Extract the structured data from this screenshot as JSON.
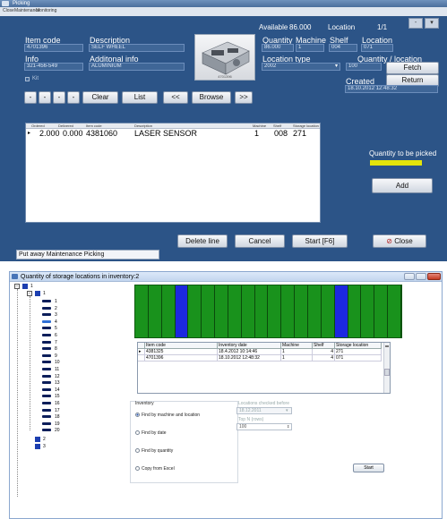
{
  "win1": {
    "title": "Picking",
    "menu": [
      "Close",
      "Maintenance",
      "Monitoring"
    ],
    "available_label": "Available",
    "available_value": "86.000",
    "location_label": "Location",
    "location_pager": "1/1",
    "item_code_label": "Item code",
    "item_code_value": "4701396",
    "description_label": "Description",
    "description_value": "SELF WHEEL",
    "info_label": "Info",
    "info_value": "321-456-549",
    "additional_info_label": "Additonal info",
    "additional_info_value": "ALUMINIUM",
    "kit_label": "Kit",
    "photo_caption": "4701396",
    "quantity_label": "Quantity",
    "quantity_value": "86.000",
    "machine_label": "Machine",
    "machine_value": "1",
    "shelf_label": "Shelf",
    "shelf_value": "004",
    "location_field_label": "Location",
    "location_field_value": "071",
    "location_type_label": "Location type",
    "location_type_value": "2002",
    "qty_location_label": "Quantity / location",
    "qty_location_value": "100",
    "created_label": "Created",
    "created_value": "18.10.2012 12:48:32",
    "buttons": {
      "nav1": "-",
      "nav2": "-",
      "nav3": "-",
      "nav4": "-",
      "clear": "Clear",
      "list": "List",
      "prev": "<<",
      "browse": "Browse",
      "next": ">>",
      "fetch": "Fetch",
      "return": "Return",
      "add": "Add",
      "delete_line": "Delete line",
      "cancel": "Cancel",
      "start": "Start [F6]",
      "close": "Close"
    },
    "table": {
      "headers": [
        "Ordered",
        "Delivered",
        "Item code",
        "Description",
        "Machine",
        "Shelf",
        "Storage location"
      ],
      "row": {
        "ordered": "2.000",
        "delivered": "0.000",
        "item_code": "4381060",
        "description": "LASER SENSOR",
        "machine": "1",
        "shelf": "008",
        "storage_location": "271"
      }
    },
    "qty_to_pick_label": "Quantity to be picked",
    "status_text": "Put away Maintenance Picking"
  },
  "win2": {
    "title": "Quantity of storage locations in inventory:2",
    "tree": {
      "root": "1",
      "child": "1",
      "leaves": [
        "1",
        "2",
        "3",
        "4",
        "5",
        "6",
        "7",
        "8",
        "9",
        "10",
        "11",
        "12",
        "13",
        "14",
        "15",
        "16",
        "17",
        "18",
        "19",
        "20"
      ],
      "after": [
        "2",
        "3"
      ]
    },
    "storage_cells": 20,
    "blue_cells": [
      4,
      16
    ],
    "grid": {
      "headers": [
        "Item code",
        "Inventory date",
        "Machine",
        "Shelf",
        "Storage location"
      ],
      "rows": [
        {
          "item_code": "4381325",
          "date": "18.4.2012 10:14:46",
          "machine": "1",
          "shelf": "4",
          "location": "271"
        },
        {
          "item_code": "4701396",
          "date": "18.10.2012 12:48:32",
          "machine": "1",
          "shelf": "4",
          "location": "071"
        }
      ]
    },
    "inventory_label": "Inventory",
    "options": [
      "Find by machine and location",
      "Find by date",
      "Find by quantity",
      "Copy from Excel"
    ],
    "locations_checked_label": "Locations checked before",
    "locations_checked_value": "18.12.2011",
    "top_n_label": "Top N (rows)",
    "top_n_value": "100",
    "start_button": "Start"
  }
}
